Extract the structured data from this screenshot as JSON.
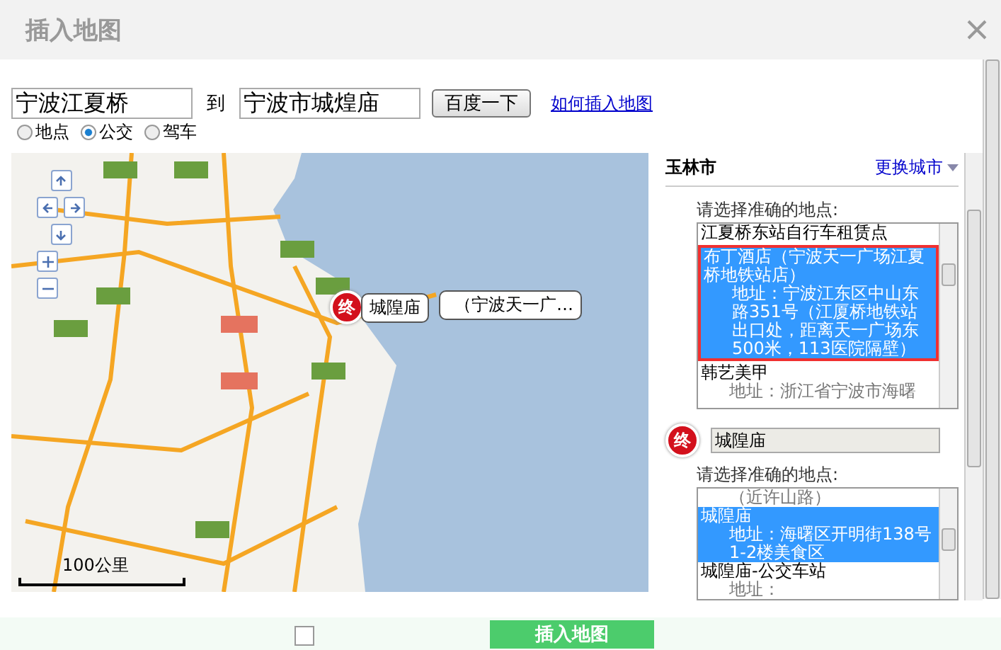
{
  "dialog": {
    "title": "插入地图"
  },
  "search": {
    "from": "宁波江夏桥",
    "connector": "到",
    "to": "宁波市城煌庙",
    "button": "百度一下",
    "help_link": "如何插入地图"
  },
  "modes": [
    {
      "label": "地点",
      "selected": false
    },
    {
      "label": "公交",
      "selected": true
    },
    {
      "label": "驾车",
      "selected": false
    }
  ],
  "map": {
    "marker": {
      "badge": "终",
      "label": "城隍庙",
      "behind_label": "（宁波天一广…"
    },
    "scale": "100公里"
  },
  "city": {
    "name": "玉林市",
    "change_link": "更换城市"
  },
  "start": {
    "prompt": "请选择准确的地点:",
    "options": [
      {
        "name": "江夏桥东站自行车租赁点",
        "selected": false,
        "highlight": false
      },
      {
        "name": "布丁酒店（宁波天一广场江夏桥地铁站店）",
        "address": "地址：宁波江东区中山东路351号（江厦桥地铁站出口处，距离天一广场东500米，113医院隔壁）",
        "selected": true,
        "highlight": true
      },
      {
        "name": "韩艺美甲",
        "address": "地址：浙江省宁波市海曙",
        "selected": false,
        "highlight": false
      }
    ]
  },
  "end": {
    "badge": "终",
    "value": "城隍庙",
    "prompt": "请选择准确的地点:",
    "options": [
      {
        "address": "（近许山路）",
        "selected": false,
        "highlight": false
      },
      {
        "name": "城隍庙",
        "address": "地址：海曙区开明街138号1-2楼美食区",
        "selected": true,
        "highlight": false
      },
      {
        "name": "城隍庙-公交车站",
        "address": "地址：",
        "selected": false,
        "highlight": false
      }
    ]
  },
  "footer": {
    "checkbox": {
      "checked": false
    },
    "button": "插入地图"
  }
}
